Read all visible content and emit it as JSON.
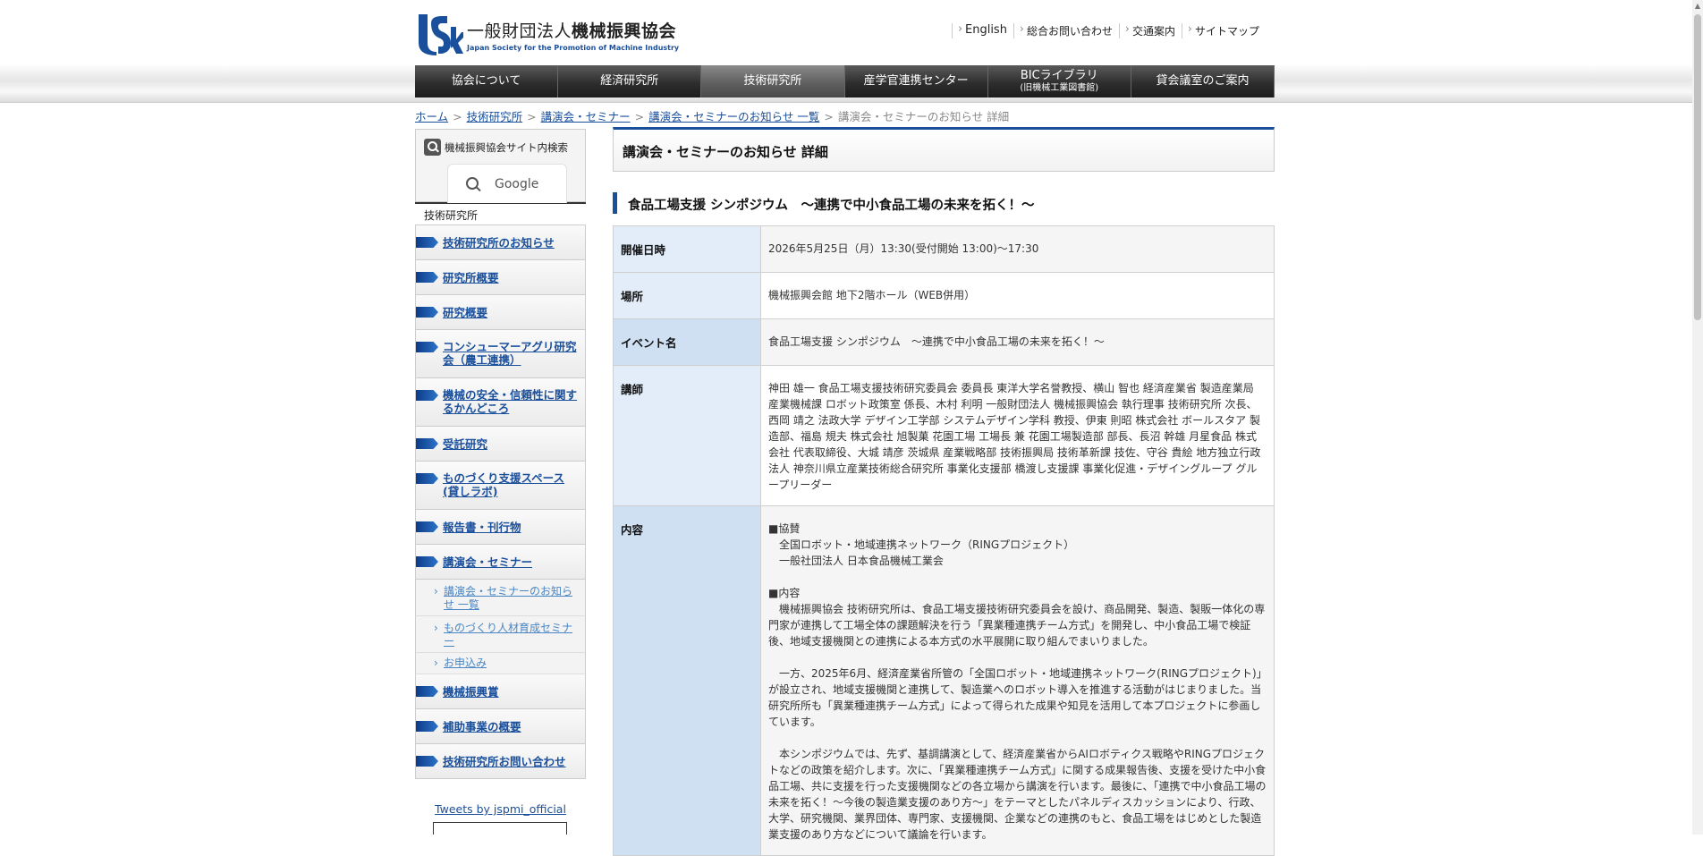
{
  "header": {
    "logo_mark": "JSMI",
    "logo_prefix": "一般財団法人",
    "logo_name": "機械振興協会",
    "logo_sub": "Japan Society for the Promotion of Machine Industry",
    "utility_links": [
      "English",
      "総合お問い合わせ",
      "交通案内",
      "サイトマップ"
    ]
  },
  "nav": {
    "items": [
      {
        "label": "協会について",
        "sub": ""
      },
      {
        "label": "経済研究所",
        "sub": ""
      },
      {
        "label": "技術研究所",
        "sub": ""
      },
      {
        "label": "産学官連携センター",
        "sub": ""
      },
      {
        "label": "BICライブラリ",
        "sub": "(旧機械工業図書館)"
      },
      {
        "label": "貸会議室のご案内",
        "sub": ""
      }
    ]
  },
  "breadcrumb": {
    "links": [
      "ホーム",
      "技術研究所",
      "講演会・セミナー",
      "講演会・セミナーのお知らせ 一覧"
    ],
    "current": "講演会・セミナーのお知らせ 詳細"
  },
  "sidebar": {
    "search_title": "機械振興協会サイト内検索",
    "google_label": "Google",
    "section_title": "技術研究所",
    "items": [
      "技術研究所のお知らせ",
      "研究所概要",
      "研究概要",
      "コンシューマーアグリ研究会（農工連携）",
      "機械の安全・信頼性に関するかんどころ",
      "受託研究",
      "ものづくり支援スペース(貸しラボ)",
      "報告書・刊行物",
      "講演会・セミナー"
    ],
    "subitems": [
      "講演会・セミナーのお知らせ 一覧",
      "ものづくり人材育成セミナー",
      "お申込み"
    ],
    "items_after": [
      "機械振興賞",
      "補助事業の概要",
      "技術研究所お問い合わせ"
    ],
    "tweets_link": "Tweets by jspmi_official"
  },
  "main": {
    "page_title": "講演会・セミナーのお知らせ 詳細",
    "event_heading": "食品工場支援 シンポジウム　～連携で中小食品工場の未来を拓く！～",
    "rows": {
      "date_label": "開催日時",
      "date_value": "2026年5月25日（月）13:30(受付開始 13:00)～17:30",
      "place_label": "場所",
      "place_value": "機械振興会館 地下2階ホール（WEB併用）",
      "event_label": "イベント名",
      "event_value": "食品工場支援 シンポジウム　～連携で中小食品工場の未来を拓く！～",
      "speaker_label": "講師",
      "speaker_value": "神田 雄一 食品工場支援技術研究委員会 委員長 東洋大学名誉教授、横山 智也 経済産業省 製造産業局 産業機械課 ロボット政策室 係長、木村 利明 一般財団法人 機械振興協会 執行理事 技術研究所 次長、西岡 靖之 法政大学 デザイン工学部 システムデザイン学科 教授、伊東 則昭 株式会社 ボールスタア 製造部、福島 規夫 株式会社 旭製菓 花園工場 工場長 兼 花園工場製造部 部長、長沼 幹雄 月星食品 株式会社 代表取締役、大城 靖彦 茨城県 産業戦略部 技術振興局 技術革新課 技佐、守谷 貴絵 地方独立行政法人 神奈川県立産業技術総合研究所 事業化支援部 橋渡し支援課 事業化促進・デザイングループ グループリーダー",
      "content_label": "内容",
      "content": {
        "cosponsor_head": "■協賛",
        "cosponsor_1": "　全国ロボット・地域連携ネットワーク（RINGプロジェクト）",
        "cosponsor_2": "　一般社団法人 日本食品機械工業会",
        "naiyou_head": "■内容",
        "para1": "　機械振興協会 技術研究所は、食品工場支援技術研究委員会を設け、商品開発、製造、製販一体化の専門家が連携して工場全体の課題解決を行う「異業種連携チーム方式」を開発し、中小食品工場で検証後、地域支援機関との連携による本方式の水平展開に取り組んでまいりました。",
        "para2": "　一方、2025年6月、経済産業省所管の「全国ロボット・地域連携ネットワーク(RINGプロジェクト)」が設立され、地域支援機関と連携して、製造業へのロボット導入を推進する活動がはじまりました。当研究所所も「異業種連携チーム方式」によって得られた成果や知見を活用して本プロジェクトに参画しています。",
        "para3": "　本シンポジウムでは、先ず、基調講演として、経済産業省からAIロボティクス戦略やRINGプロジェクトなどの政策を紹介します。次に、「異業種連携チーム方式」に関する成果報告後、支援を受けた中小食品工場、共に支援を行った支援機関などの各立場から講演を行います。最後に、「連携で中小食品工場の未来を拓く！～今後の製造業支援のあり方～」をテーマとしたパネルディスカッションにより、行政、大学、研究機関、業界団体、専門家、支援機関、企業などの連携のもと、食品工場をはじめとした製造業支援のあり方などについて議論を行います。"
      }
    }
  },
  "colors": {
    "brand_blue": "#1a4f9c",
    "table_head": "#cfe0f3",
    "nav_dark": "#2e2e2e"
  }
}
